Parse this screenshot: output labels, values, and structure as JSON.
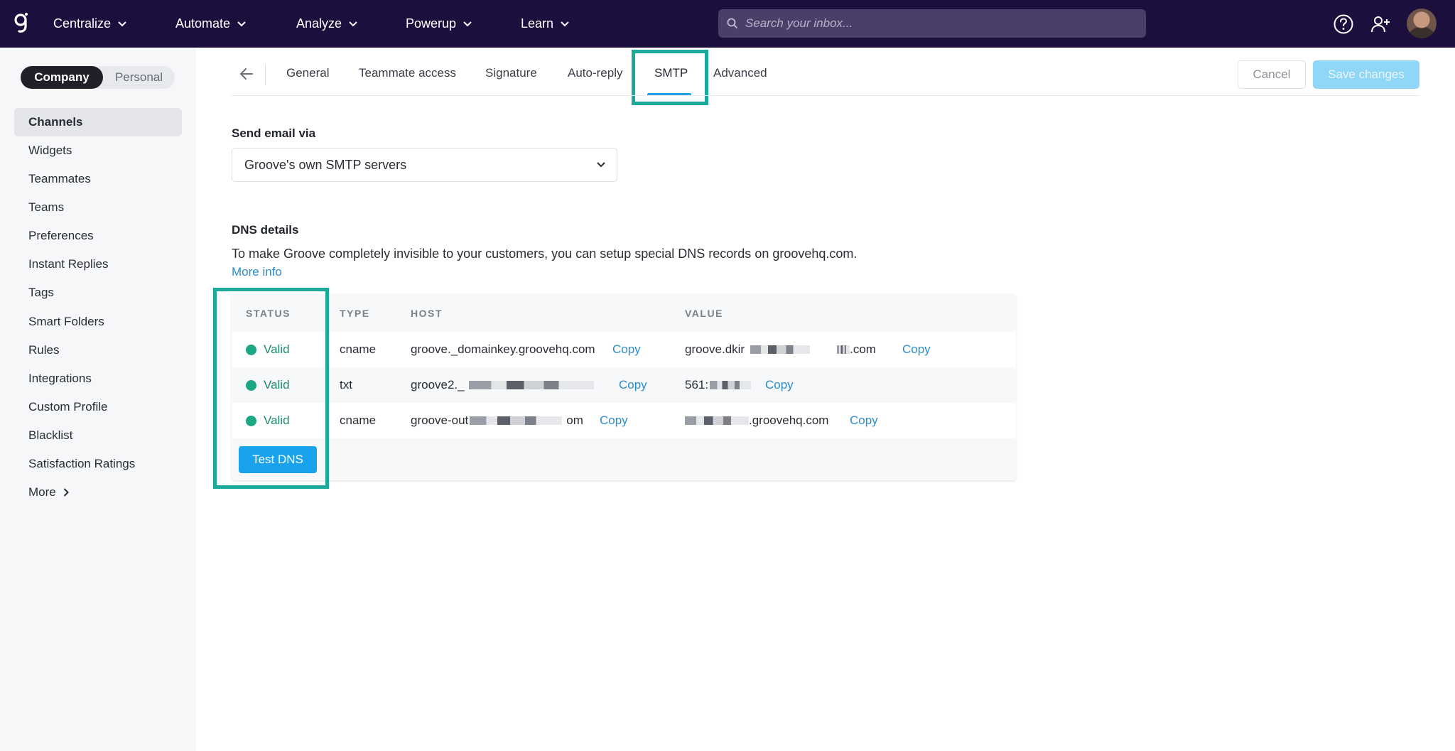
{
  "topnav": {
    "items": [
      {
        "label": "Centralize"
      },
      {
        "label": "Automate"
      },
      {
        "label": "Analyze"
      },
      {
        "label": "Powerup"
      },
      {
        "label": "Learn"
      }
    ],
    "search_placeholder": "Search your inbox..."
  },
  "sidebar": {
    "toggle": {
      "company": "Company",
      "personal": "Personal"
    },
    "items": [
      {
        "label": "Channels"
      },
      {
        "label": "Widgets"
      },
      {
        "label": "Teammates"
      },
      {
        "label": "Teams"
      },
      {
        "label": "Preferences"
      },
      {
        "label": "Instant Replies"
      },
      {
        "label": "Tags"
      },
      {
        "label": "Smart Folders"
      },
      {
        "label": "Rules"
      },
      {
        "label": "Integrations"
      },
      {
        "label": "Custom Profile"
      },
      {
        "label": "Blacklist"
      },
      {
        "label": "Satisfaction Ratings"
      },
      {
        "label": "More"
      }
    ]
  },
  "tabs": [
    {
      "label": "General"
    },
    {
      "label": "Teammate access"
    },
    {
      "label": "Signature"
    },
    {
      "label": "Auto-reply"
    },
    {
      "label": "SMTP"
    },
    {
      "label": "Advanced"
    }
  ],
  "header": {
    "cancel_label": "Cancel",
    "save_label": "Save changes"
  },
  "send_via": {
    "label": "Send email via",
    "selected": "Groove's own SMTP servers"
  },
  "dns": {
    "title": "DNS details",
    "description": "To make Groove completely invisible to your customers, you can setup special DNS records on groovehq.com.",
    "more_info": "More info",
    "columns": {
      "status": "STATUS",
      "type": "TYPE",
      "host": "HOST",
      "value": "VALUE"
    },
    "rows": [
      {
        "status": "Valid",
        "type": "cname",
        "host": "groove._domainkey.groovehq.com",
        "value_start": "groove.dkir",
        "value_end": ".com",
        "copy": "Copy"
      },
      {
        "status": "Valid",
        "type": "txt",
        "host": "groove2._",
        "value_start": "561:",
        "value_end": "",
        "copy": "Copy"
      },
      {
        "status": "Valid",
        "type": "cname",
        "host": "groove-out",
        "host_end": "om",
        "value_start": "",
        "value_end": ".groovehq.com",
        "copy": "Copy"
      }
    ],
    "test_button": "Test DNS"
  },
  "colors": {
    "accent": "#1aa3ec",
    "highlight": "#1aa99a",
    "valid": "#1ba784",
    "nav_bg": "#1c0f3d"
  }
}
